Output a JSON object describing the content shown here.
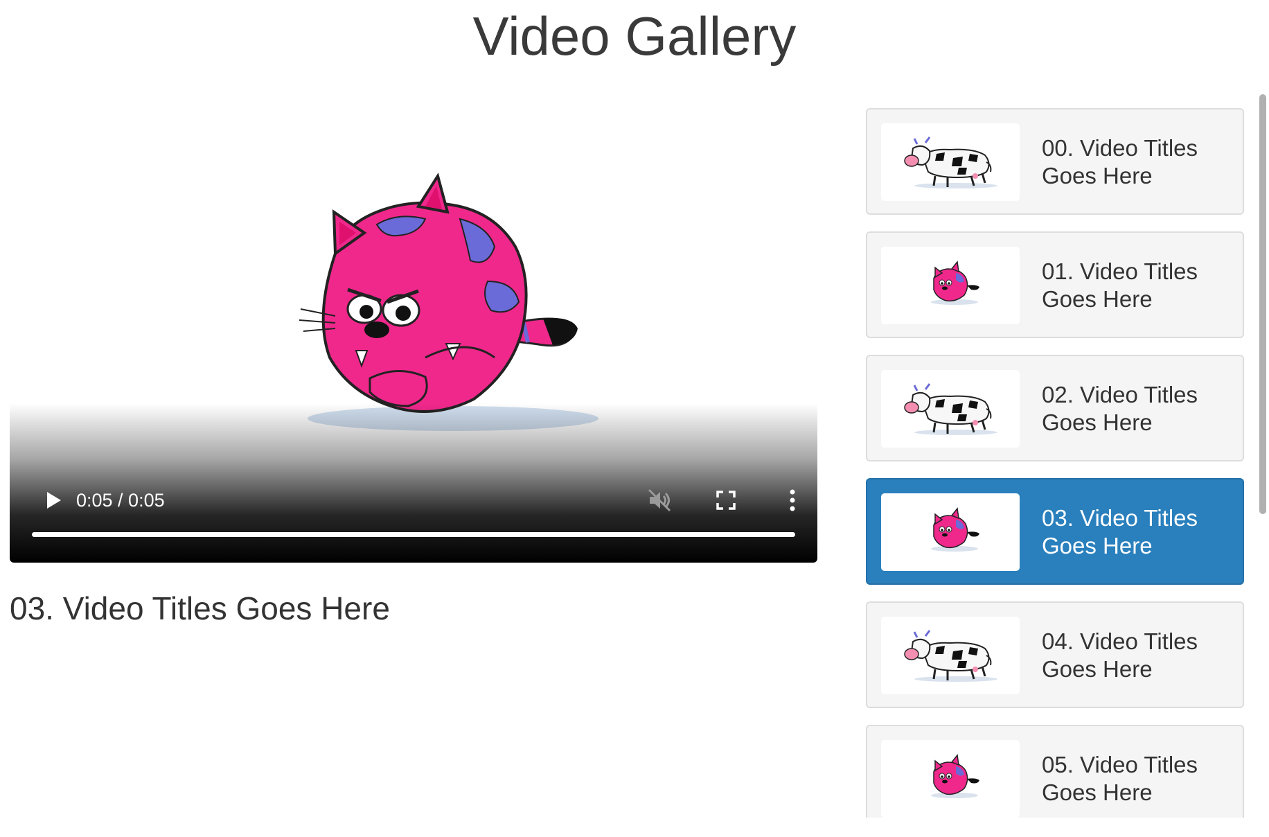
{
  "page": {
    "title": "Video Gallery"
  },
  "player": {
    "time_display": "0:05 / 0:05",
    "progress": 1.0,
    "muted": true,
    "current_title": "03. Video Titles Goes Here",
    "icons": {
      "play": "play-icon",
      "mute": "muted-speaker-icon",
      "fullscreen": "fullscreen-icon",
      "more": "more-vertical-icon"
    }
  },
  "playlist": {
    "active_index": 3,
    "items": [
      {
        "title": "00. Video Titles Goes Here",
        "thumbnail": "cow"
      },
      {
        "title": "01. Video Titles Goes Here",
        "thumbnail": "cat"
      },
      {
        "title": "02. Video Titles Goes Here",
        "thumbnail": "cow"
      },
      {
        "title": "03. Video Titles Goes Here",
        "thumbnail": "cat"
      },
      {
        "title": "04. Video Titles Goes Here",
        "thumbnail": "cow"
      },
      {
        "title": "05. Video Titles Goes Here",
        "thumbnail": "cat"
      }
    ]
  },
  "colors": {
    "active_item": "#2a80bd",
    "item_background": "#f5f5f5",
    "item_border": "#dddddd",
    "cat_pink": "#f0288c",
    "cat_purple": "#6a6ad8"
  }
}
